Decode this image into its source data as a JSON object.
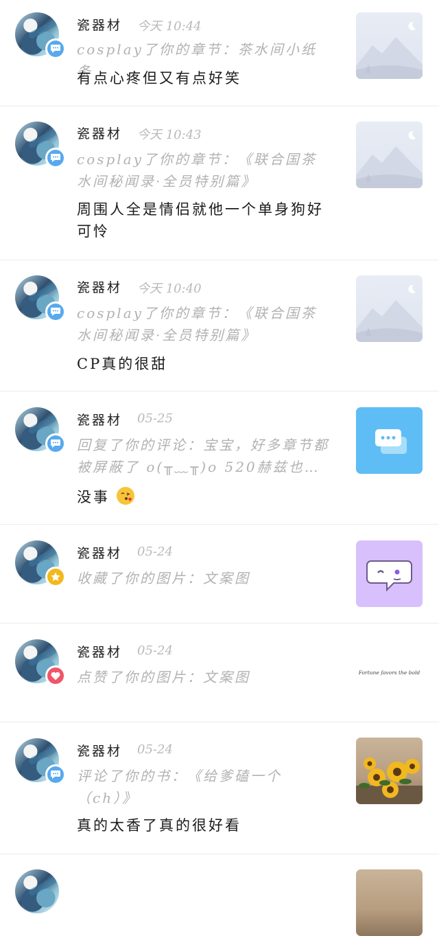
{
  "notifications": [
    {
      "user_name": "瓷器材",
      "time": "今天 10:44",
      "action": "cosplay了你的章节：茶水间小纸条",
      "content": "有点心疼但又有点好笑",
      "badge_icon": "comment-icon",
      "thumb_icon": "mountain-placeholder-icon"
    },
    {
      "user_name": "瓷器材",
      "time": "今天 10:43",
      "action": "cosplay了你的章节：《联合国茶水间秘闻录·全员特别篇》",
      "content": "周围人全是情侣就他一个单身狗好可怜",
      "badge_icon": "comment-icon",
      "thumb_icon": "mountain-placeholder-icon"
    },
    {
      "user_name": "瓷器材",
      "time": "今天 10:40",
      "action": "cosplay了你的章节：《联合国茶水间秘闻录·全员特别篇》",
      "content": "CP真的很甜",
      "badge_icon": "comment-icon",
      "thumb_icon": "mountain-placeholder-icon"
    },
    {
      "user_name": "瓷器材",
      "time": "05-25",
      "action": "回复了你的评论：宝宝，好多章节都被屏蔽了 o(╥﹏╥)o 520赫兹也…",
      "content": "没事",
      "badge_icon": "comment-icon",
      "thumb_icon": "chat-bubbles-icon"
    },
    {
      "user_name": "瓷器材",
      "time": "05-24",
      "action": "收藏了你的图片：文案图",
      "content": "",
      "badge_icon": "star-icon",
      "thumb_icon": "wink-bubble-icon"
    },
    {
      "user_name": "瓷器材",
      "time": "05-24",
      "action": "点赞了你的图片：文案图",
      "content": "",
      "badge_icon": "heart-icon",
      "thumb_text": "Fortune favors the bold"
    },
    {
      "user_name": "瓷器材",
      "time": "05-24",
      "action": "评论了你的书：《给爹磕一个（ch）》",
      "content": "真的太香了真的很好看",
      "badge_icon": "comment-icon",
      "thumb_icon": "sunflower-photo"
    }
  ]
}
